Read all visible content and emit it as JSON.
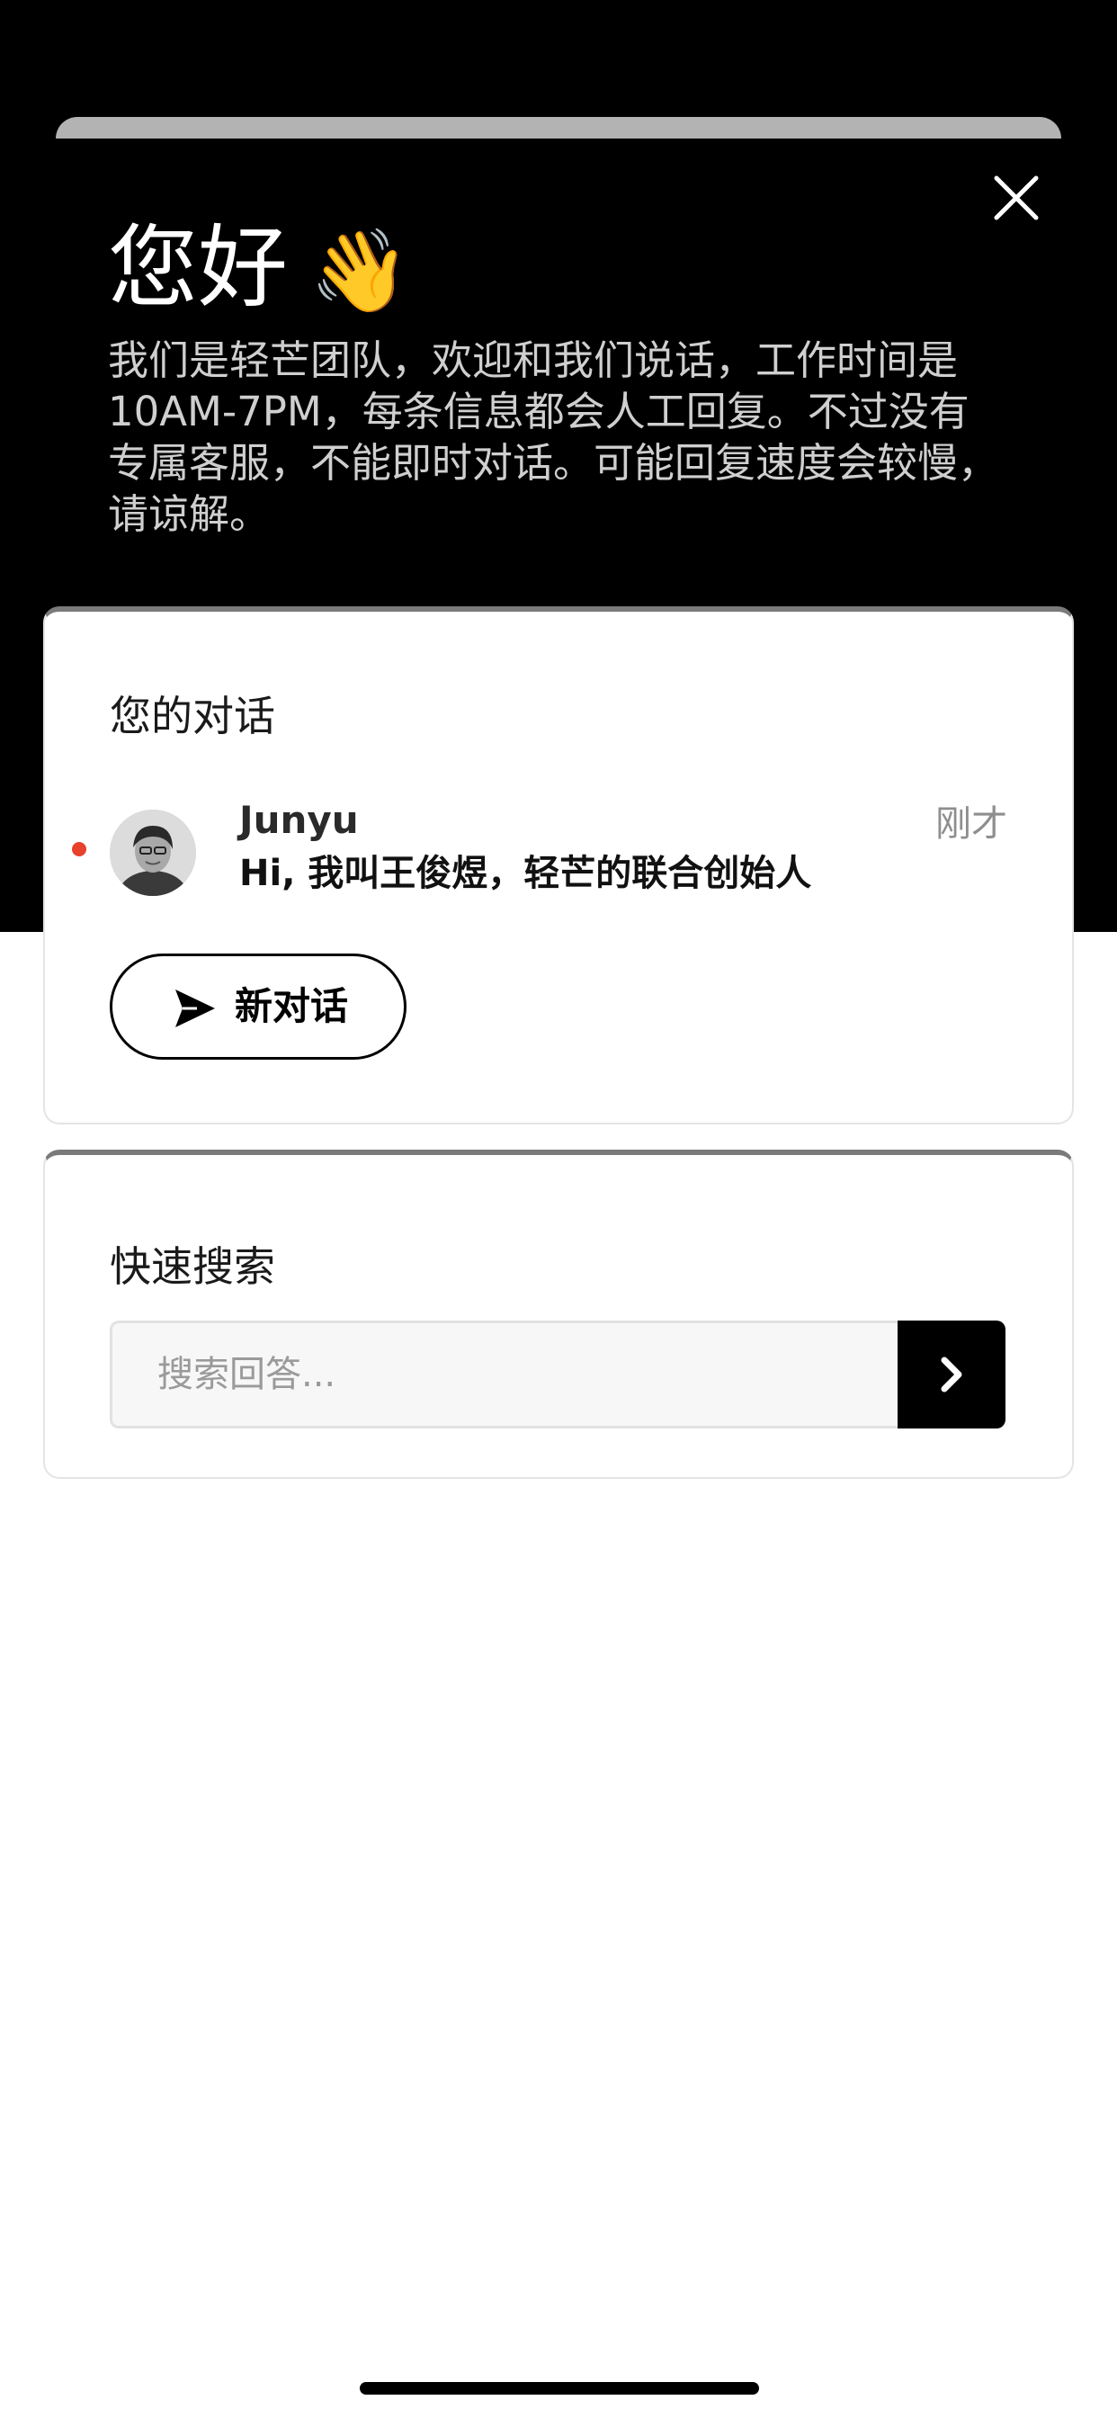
{
  "header": {
    "greeting": "您好",
    "greeting_emoji": "👋",
    "intro": "我们是轻芒团队，欢迎和我们说话，工作时间是10AM-7PM，每条信息都会人工回复。不过没有专属客服，不能即时对话。可能回复速度会较慢，请谅解。",
    "close_icon": "close-icon"
  },
  "conversations": {
    "title": "您的对话",
    "items": [
      {
        "name": "Junyu",
        "time": "刚才",
        "message": "Hi, 我叫王俊煜，轻芒的联合创始人",
        "unread": true,
        "avatar": "avatar-photo"
      }
    ],
    "new_button_label": "新对话",
    "new_button_icon": "send-icon"
  },
  "search": {
    "title": "快速搜索",
    "placeholder": "搜索回答...",
    "submit_icon": "chevron-right-icon"
  },
  "colors": {
    "header_bg": "#000000",
    "accent": "#000000",
    "unread_dot": "#e8412c",
    "card_top_border": "#7a7a7a"
  }
}
